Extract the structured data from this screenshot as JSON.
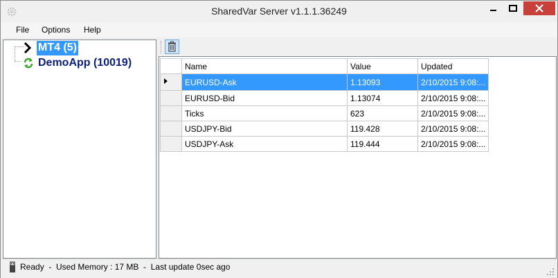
{
  "window": {
    "title": "SharedVar Server v1.1.1.36249"
  },
  "menu": [
    "File",
    "Options",
    "Help"
  ],
  "tree": {
    "nodes": [
      {
        "label": "MT4 (5)",
        "icon": "chevron-right-icon",
        "selected": true
      },
      {
        "label": "DemoApp (10019)",
        "icon": "refresh-icon",
        "selected": false
      }
    ]
  },
  "grid": {
    "columns": [
      "Name",
      "Value",
      "Updated"
    ],
    "rows": [
      {
        "name": "EURUSD-Ask",
        "value": "1.13093",
        "updated": "2/10/2015 9:08:...",
        "selected": true
      },
      {
        "name": "EURUSD-Bid",
        "value": "1.13074",
        "updated": "2/10/2015 9:08:..."
      },
      {
        "name": "Ticks",
        "value": "623",
        "updated": "2/10/2015 9:08:..."
      },
      {
        "name": "USDJPY-Bid",
        "value": "119.428",
        "updated": "2/10/2015 9:08:..."
      },
      {
        "name": "USDJPY-Ask",
        "value": "119.444",
        "updated": "2/10/2015 9:08:..."
      }
    ]
  },
  "status": {
    "text": "Ready  -  Used Memory : 17 MB  -  Last update 0sec ago"
  },
  "colors": {
    "selection": "#3399ff",
    "close_button": "#c7403a"
  },
  "icons": {
    "app": "gear-icon",
    "toolbar_delete": "trash-icon",
    "status": "usb-plug-icon"
  }
}
